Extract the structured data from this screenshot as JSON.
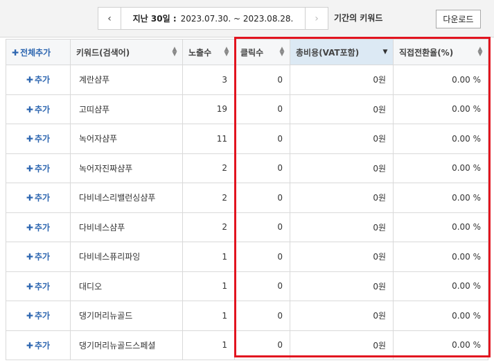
{
  "period": {
    "prev_icon": "chevron-left-icon",
    "next_icon": "chevron-right-icon",
    "label": "지난 30일 :",
    "range": "2023.07.30. ~ 2023.08.28.",
    "suffix": "기간의 키워드"
  },
  "download_label": "다운로드",
  "table": {
    "headers": {
      "add_all": "전체추가",
      "keyword": "키워드(검색어)",
      "impressions": "노출수",
      "clicks": "클릭수",
      "total_cost": "총비용(VAT포함)",
      "conversion_rate": "직접전환율(%)"
    },
    "sorted_column": "total_cost",
    "add_label": "추가",
    "rows": [
      {
        "keyword": "계란샴푸",
        "impressions": "3",
        "clicks": "0",
        "cost": "0원",
        "conv": "0.00 %"
      },
      {
        "keyword": "고띠샴푸",
        "impressions": "19",
        "clicks": "0",
        "cost": "0원",
        "conv": "0.00 %"
      },
      {
        "keyword": "녹어자샴푸",
        "impressions": "11",
        "clicks": "0",
        "cost": "0원",
        "conv": "0.00 %"
      },
      {
        "keyword": "녹어자진짜샴푸",
        "impressions": "2",
        "clicks": "0",
        "cost": "0원",
        "conv": "0.00 %"
      },
      {
        "keyword": "다비네스리밸런싱샴푸",
        "impressions": "2",
        "clicks": "0",
        "cost": "0원",
        "conv": "0.00 %"
      },
      {
        "keyword": "다비네스샴푸",
        "impressions": "2",
        "clicks": "0",
        "cost": "0원",
        "conv": "0.00 %"
      },
      {
        "keyword": "다비네스퓨리파잉",
        "impressions": "1",
        "clicks": "0",
        "cost": "0원",
        "conv": "0.00 %"
      },
      {
        "keyword": "대디오",
        "impressions": "1",
        "clicks": "0",
        "cost": "0원",
        "conv": "0.00 %"
      },
      {
        "keyword": "댕기머리뉴골드",
        "impressions": "1",
        "clicks": "0",
        "cost": "0원",
        "conv": "0.00 %"
      },
      {
        "keyword": "댕기머리뉴골드스페셜",
        "impressions": "1",
        "clicks": "0",
        "cost": "0원",
        "conv": "0.00 %"
      }
    ]
  },
  "colors": {
    "highlight": "#e2141f",
    "accent": "#2d66b0",
    "sorted_header": "#dce9f4"
  }
}
